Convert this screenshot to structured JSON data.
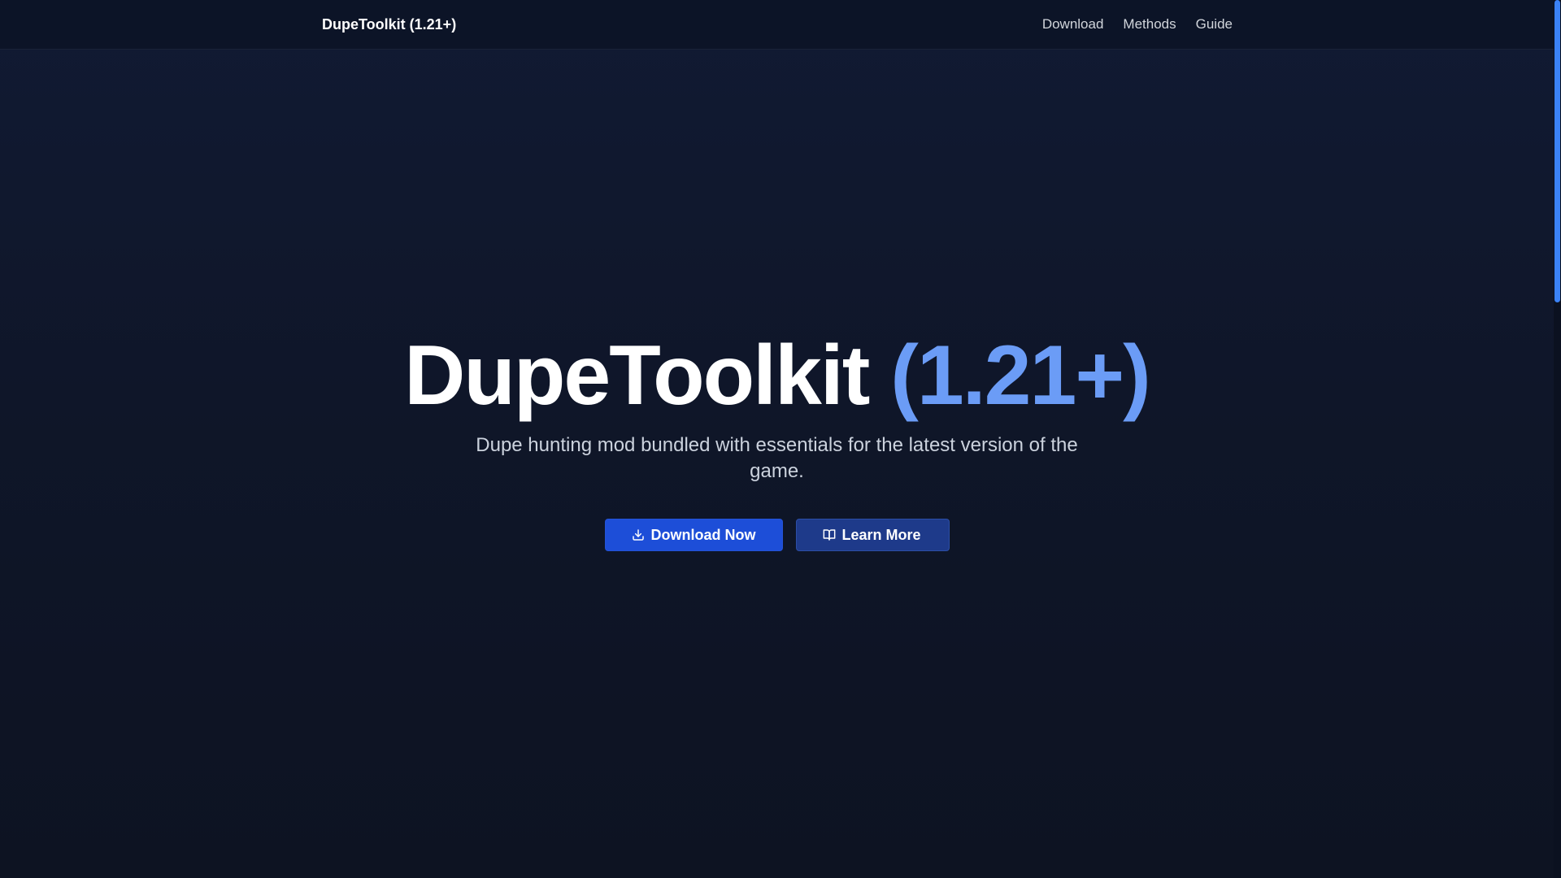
{
  "navbar": {
    "brand": "DupeToolkit (1.21+)",
    "links": [
      "Download",
      "Methods",
      "Guide"
    ]
  },
  "hero": {
    "title_main": "DupeToolkit",
    "title_accent": "(1.21+)",
    "subtitle": "Dupe hunting mod bundled with essentials for the latest version of the game.",
    "primary_button": {
      "label": "Download Now",
      "icon": "download-icon"
    },
    "secondary_button": {
      "label": "Learn More",
      "icon": "book-open-icon"
    }
  },
  "colors": {
    "accent": "#6b9cf6",
    "primary_button": "#1d4ed8",
    "secondary_button": "#1e3a8a",
    "background": "#0f1629",
    "scrollbar": "#3b82f6"
  }
}
